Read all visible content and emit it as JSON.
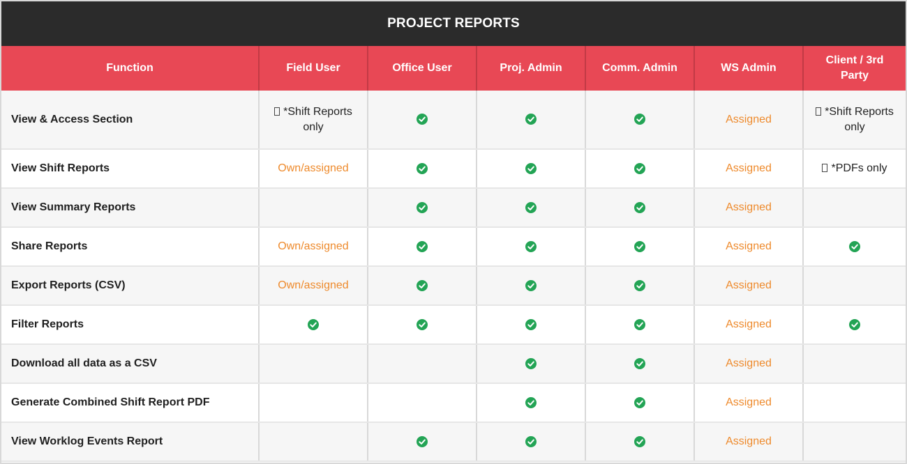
{
  "title": "PROJECT REPORTS",
  "columns": [
    "Function",
    "Field User",
    "Office User",
    "Proj. Admin",
    "Comm. Admin",
    "WS Admin",
    "Client / 3rd Party"
  ],
  "icons": {
    "check": "check-circle-icon",
    "note": "note-box-icon"
  },
  "colors": {
    "header_bg": "#2b2b2b",
    "column_header_bg": "#e84855",
    "assigned_text": "#ee8a2c",
    "check": "#23a455"
  },
  "rows": [
    {
      "function": "View & Access Section",
      "cells": [
        {
          "type": "note",
          "text": "*Shift Reports only"
        },
        {
          "type": "check"
        },
        {
          "type": "check"
        },
        {
          "type": "check"
        },
        {
          "type": "text",
          "text": "Assigned"
        },
        {
          "type": "note",
          "text": "*Shift Reports only"
        }
      ]
    },
    {
      "function": "View Shift Reports",
      "cells": [
        {
          "type": "text",
          "text": "Own/assigned"
        },
        {
          "type": "check"
        },
        {
          "type": "check"
        },
        {
          "type": "check"
        },
        {
          "type": "text",
          "text": "Assigned"
        },
        {
          "type": "note",
          "text": "*PDFs only"
        }
      ]
    },
    {
      "function": "View Summary Reports",
      "cells": [
        {
          "type": "empty"
        },
        {
          "type": "check"
        },
        {
          "type": "check"
        },
        {
          "type": "check"
        },
        {
          "type": "text",
          "text": "Assigned"
        },
        {
          "type": "empty"
        }
      ]
    },
    {
      "function": "Share Reports",
      "cells": [
        {
          "type": "text",
          "text": "Own/assigned"
        },
        {
          "type": "check"
        },
        {
          "type": "check"
        },
        {
          "type": "check"
        },
        {
          "type": "text",
          "text": "Assigned"
        },
        {
          "type": "check"
        }
      ]
    },
    {
      "function": "Export Reports (CSV)",
      "cells": [
        {
          "type": "text",
          "text": "Own/assigned"
        },
        {
          "type": "check"
        },
        {
          "type": "check"
        },
        {
          "type": "check"
        },
        {
          "type": "text",
          "text": "Assigned"
        },
        {
          "type": "empty"
        }
      ]
    },
    {
      "function": "Filter Reports",
      "cells": [
        {
          "type": "check"
        },
        {
          "type": "check"
        },
        {
          "type": "check"
        },
        {
          "type": "check"
        },
        {
          "type": "text",
          "text": "Assigned"
        },
        {
          "type": "check"
        }
      ]
    },
    {
      "function": "Download all data as a CSV",
      "cells": [
        {
          "type": "empty"
        },
        {
          "type": "empty"
        },
        {
          "type": "check"
        },
        {
          "type": "check"
        },
        {
          "type": "text",
          "text": "Assigned"
        },
        {
          "type": "empty"
        }
      ]
    },
    {
      "function": "Generate Combined Shift Report PDF",
      "cells": [
        {
          "type": "empty"
        },
        {
          "type": "empty"
        },
        {
          "type": "check"
        },
        {
          "type": "check"
        },
        {
          "type": "text",
          "text": "Assigned"
        },
        {
          "type": "empty"
        }
      ]
    },
    {
      "function": "View Worklog Events Report",
      "cells": [
        {
          "type": "empty"
        },
        {
          "type": "check"
        },
        {
          "type": "check"
        },
        {
          "type": "check"
        },
        {
          "type": "text",
          "text": "Assigned"
        },
        {
          "type": "empty"
        }
      ]
    }
  ]
}
